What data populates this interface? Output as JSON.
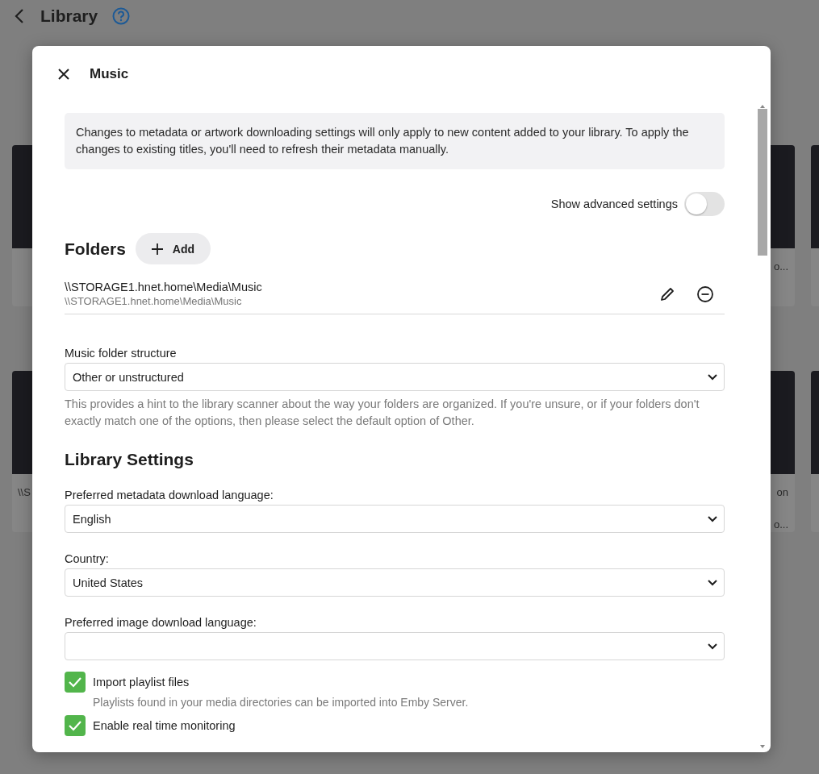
{
  "page": {
    "title": "Library"
  },
  "background_left_cards": [
    {
      "captions": [
        "\\\\S"
      ]
    }
  ],
  "background_right_cards": [
    {
      "captions": [
        "o..."
      ]
    },
    {
      "captions": [
        "on",
        "o..."
      ]
    }
  ],
  "dialog": {
    "title": "Music",
    "notice": "Changes to metadata or artwork downloading settings will only apply to new content added to your library. To apply the changes to existing titles, you'll need to refresh their metadata manually.",
    "advanced_toggle": {
      "label": "Show advanced settings",
      "on": false
    },
    "folders": {
      "heading": "Folders",
      "add_button": "Add",
      "items": [
        {
          "path": "\\\\STORAGE1.hnet.home\\Media\\Music",
          "subpath": "\\\\STORAGE1.hnet.home\\Media\\Music"
        }
      ]
    },
    "folder_structure": {
      "label": "Music folder structure",
      "value": "Other or unstructured",
      "help": "This provides a hint to the library scanner about the way your folders are organized. If you're unsure, or if your folders don't exactly match one of the options, then please select the default option of Other."
    },
    "library_settings": {
      "heading": "Library Settings",
      "fields": [
        {
          "label": "Preferred metadata download language:",
          "value": "English"
        },
        {
          "label": "Country:",
          "value": "United States"
        },
        {
          "label": "Preferred image download language:"
        }
      ]
    },
    "options": [
      {
        "label": "Import playlist files",
        "checked": true,
        "description": "Playlists found in your media directories can be imported into Emby Server."
      },
      {
        "label": "Enable real time monitoring",
        "checked": true
      }
    ]
  }
}
